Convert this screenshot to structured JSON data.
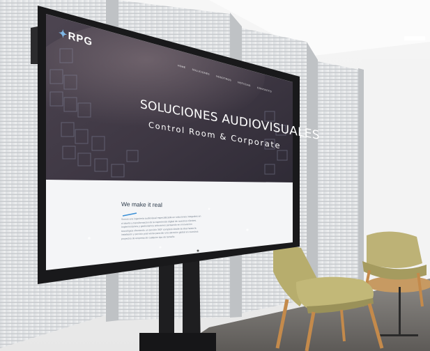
{
  "screen": {
    "brand": "RPG",
    "nav": [
      "HOME",
      "SOLUCIONES",
      "NOSOTROS",
      "NOTICIAS",
      "CONTACTO"
    ],
    "hero_title": "SOLUCIONES AUDIOVISUALES",
    "hero_subtitle": "Control Room & Corporate",
    "section_heading": "We make it real",
    "body_lines": [
      "Somos una ingeniería audiovisual especializada en soluciones integrales en",
      "el diseño y transformación de la experiencia digital de nuestros clientes.",
      "Implementamos y gestionamos soluciones pensando en innovación",
      "tecnológica ofreciendo un servicio 360º completo desde la idea hasta la",
      "instalación y servicio post-venta para dar una atención global en nuestros",
      "proyectos de empresa de cualquier tipo de tamaño."
    ]
  },
  "colors": {
    "hero_bg": "#4a4250",
    "body_bg": "#f4f5f7",
    "accent": "#3a8fd6",
    "bezel": "#1b1b1d",
    "chair": "#b7ad6d",
    "wall": "#f2f2f2"
  }
}
